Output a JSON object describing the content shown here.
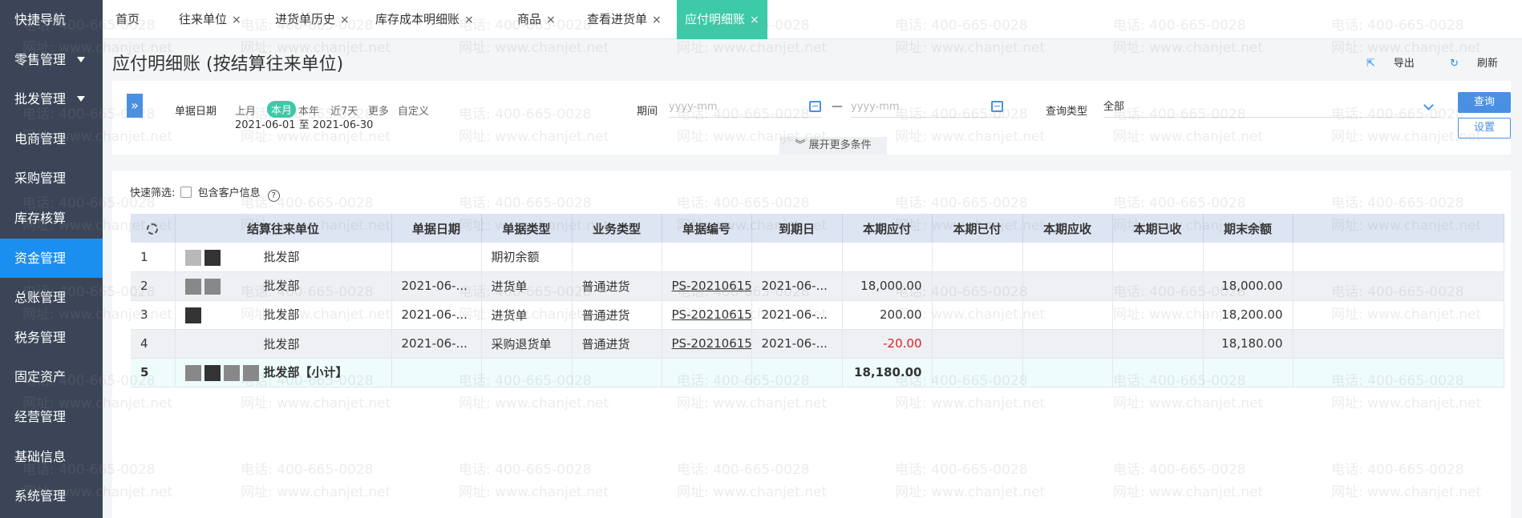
{
  "sidebar": {
    "items": [
      {
        "label": "快捷导航",
        "caret": false
      },
      {
        "label": "零售管理",
        "caret": true
      },
      {
        "label": "批发管理",
        "caret": true
      },
      {
        "label": "电商管理",
        "caret": false
      },
      {
        "label": "采购管理",
        "caret": false
      },
      {
        "label": "库存核算",
        "caret": false
      },
      {
        "label": "资金管理",
        "caret": false,
        "active": true
      },
      {
        "label": "总账管理",
        "caret": false
      },
      {
        "label": "税务管理",
        "caret": false
      },
      {
        "label": "固定资产",
        "caret": false
      },
      {
        "label": "经营管理",
        "caret": false
      },
      {
        "label": "基础信息",
        "caret": false
      },
      {
        "label": "系统管理",
        "caret": false
      }
    ]
  },
  "tabs": [
    {
      "label": "首页",
      "closable": false
    },
    {
      "label": "往来单位",
      "closable": true
    },
    {
      "label": "进货单历史",
      "closable": true
    },
    {
      "label": "库存成本明细账",
      "closable": true
    },
    {
      "label": "商品",
      "closable": true
    },
    {
      "label": "查看进货单",
      "closable": true
    },
    {
      "label": "应付明细账",
      "closable": true,
      "active": true
    }
  ],
  "close_glyph": "×",
  "header": {
    "title": "应付明细账 (按结算往来单位)",
    "export_label": "导出",
    "refresh_label": "刷新"
  },
  "filter": {
    "doc_date_label": "单据日期",
    "quick_dates": [
      "上月",
      "本月",
      "本年",
      "近7天",
      "更多",
      "自定义"
    ],
    "active_quick_date": "本月",
    "date_range": "2021-06-01 至 2021-06-30",
    "period_label": "期间",
    "period_from_placeholder": "yyyy-mm",
    "period_to_placeholder": "yyyy-mm",
    "period_sep": "—",
    "query_type_label": "查询类型",
    "query_type_value": "全部",
    "query_button": "查询",
    "setting_button": "设置",
    "more_conditions": "展开更多条件"
  },
  "quick_filter": {
    "label": "快速筛选:",
    "include_customer_label": "包含客户信息",
    "include_customer_checked": false
  },
  "table": {
    "columns": [
      "",
      "结算往来单位",
      "单据日期",
      "单据类型",
      "业务类型",
      "单据编号",
      "到期日",
      "本期应付",
      "本期已付",
      "本期应收",
      "本期已收",
      "期末余额",
      ""
    ],
    "rows": [
      {
        "no": "1",
        "unit": "批发部",
        "date": "",
        "doc_type": "期初余额",
        "biz_type": "",
        "doc_no": "",
        "due": "",
        "payable": "",
        "paid": "",
        "receivable": "",
        "received": "",
        "balance": ""
      },
      {
        "no": "2",
        "unit": "批发部",
        "date": "2021-06-...",
        "doc_type": "进货单",
        "biz_type": "普通进货",
        "doc_no": "PS-20210615",
        "due": "2021-06-...",
        "payable": "18,000.00",
        "paid": "",
        "receivable": "",
        "received": "",
        "balance": "18,000.00"
      },
      {
        "no": "3",
        "unit": "批发部",
        "date": "2021-06-...",
        "doc_type": "进货单",
        "biz_type": "普通进货",
        "doc_no": "PS-20210615",
        "due": "2021-06-...",
        "payable": "200.00",
        "paid": "",
        "receivable": "",
        "received": "",
        "balance": "18,200.00"
      },
      {
        "no": "4",
        "unit": "批发部",
        "date": "2021-06-...",
        "doc_type": "采购退货单",
        "biz_type": "普通进货",
        "doc_no": "PS-20210615",
        "due": "2021-06-...",
        "payable": "-20.00",
        "paid": "",
        "receivable": "",
        "received": "",
        "balance": "18,180.00"
      }
    ],
    "subtotal": {
      "no": "5",
      "unit": "批发部【小计】",
      "payable": "18,180.00"
    }
  },
  "watermark": {
    "phone": "电话: 400-665-0028",
    "site": "网址: www.chanjet.net"
  },
  "colors": {
    "sidebar_bg": "#3b4557",
    "sidebar_active": "#1a8ff0",
    "tab_active": "#3ccaa8",
    "primary_button": "#4a90e2",
    "table_header": "#dde4f2",
    "negative": "#e02020"
  }
}
